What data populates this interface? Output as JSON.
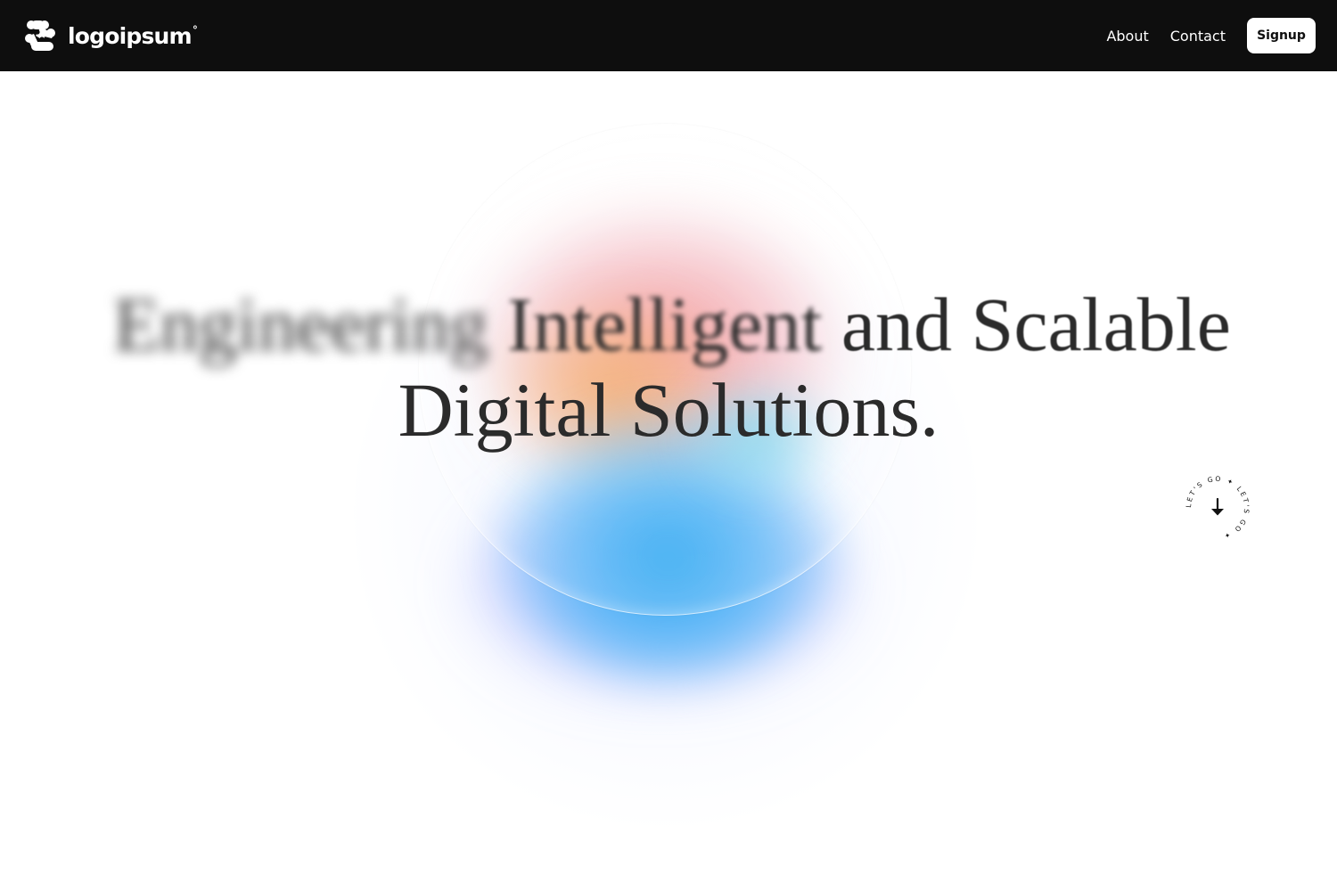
{
  "brand": {
    "name": "logoipsum",
    "sup": "°"
  },
  "nav": {
    "links": [
      {
        "label": "About"
      },
      {
        "label": "Contact"
      }
    ],
    "signup_label": "Signup"
  },
  "hero": {
    "headline": {
      "line1_part1": "Engineering",
      "line1_part2": "Intelligent",
      "line1_part3": "and Scalable",
      "line2": "Digital Solutions."
    },
    "scroll_badge": {
      "ring_text": "LET'S GO ✦ LET'S GO ✦ ",
      "icon": "arrow-down-icon"
    }
  },
  "colors": {
    "navbar_bg": "#0e0e0e",
    "text_dark": "#2b2b2b",
    "glow_pink": "#f28080",
    "glow_orange": "#f2aa5a",
    "glow_blue": "#28aaf0",
    "glow_purple": "#6e78fa"
  }
}
